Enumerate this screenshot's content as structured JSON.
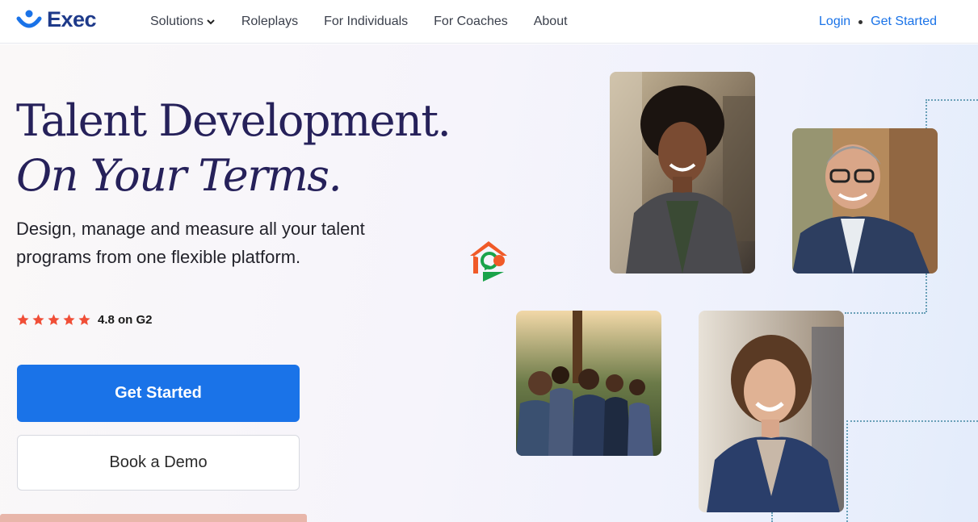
{
  "header": {
    "logo_text": "Exec",
    "nav": [
      {
        "label": "Solutions"
      },
      {
        "label": "Roleplays"
      },
      {
        "label": "For Individuals"
      },
      {
        "label": "For Coaches"
      },
      {
        "label": "About"
      }
    ],
    "login_label": "Login",
    "get_started_label": "Get Started"
  },
  "hero": {
    "title_line1": "Talent Development.",
    "title_line2": "On Your Terms.",
    "subtitle": "Design, manage and measure all your talent programs from one flexible platform.",
    "rating_value": 4.8,
    "rating_text": "4.8 on G2",
    "primary_button": "Get Started",
    "secondary_button": "Book a Demo"
  },
  "colors": {
    "brand": "#1e3a8a",
    "accent": "#1a73e8",
    "title": "#26215a",
    "star": "#f04e37"
  },
  "icons": [
    "smile-logo-icon",
    "chevron-down-icon",
    "star-icon",
    "floating-badge-icon"
  ]
}
